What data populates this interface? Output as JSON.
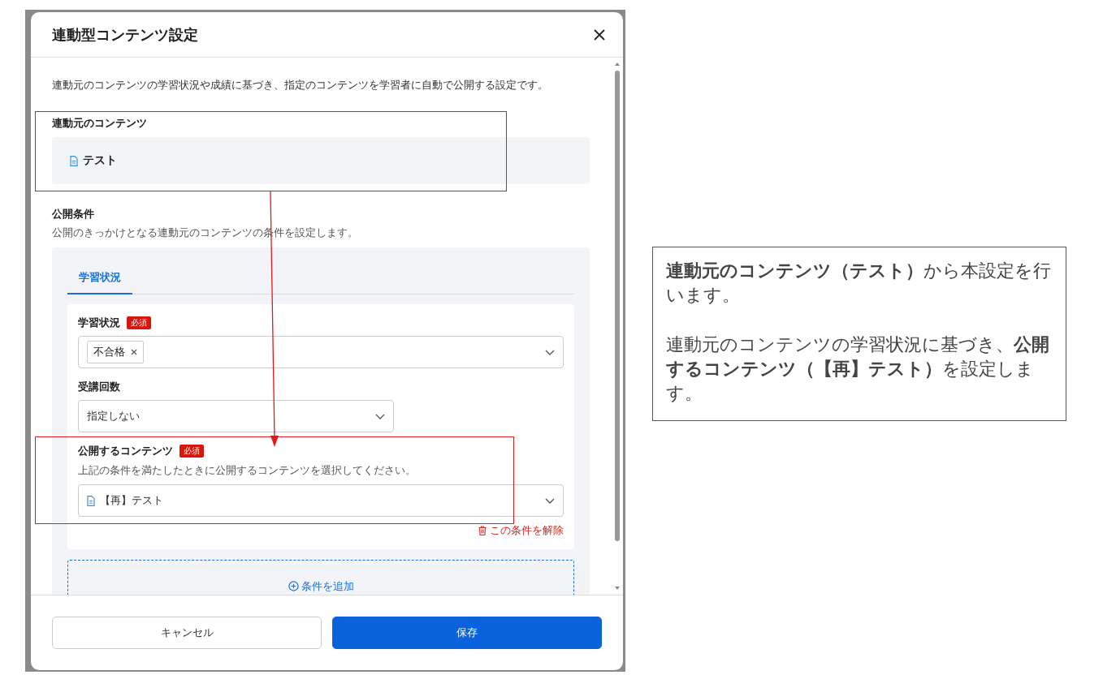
{
  "dialog": {
    "title": "連動型コンテンツ設定",
    "description": "連動元のコンテンツの学習状況や成績に基づき、指定のコンテンツを学習者に自動で公開する設定です。",
    "source": {
      "label": "連動元のコンテンツ",
      "item": "テスト"
    },
    "conditions": {
      "label": "公開条件",
      "description": "公開のきっかけとなる連動元のコンテンツの条件を設定します。",
      "tabs": [
        {
          "label": "学習状況",
          "selected": true
        }
      ],
      "fields": [
        {
          "kind": "multiselect",
          "label": "学習状況",
          "badge": "必須",
          "tags": [
            "不合格"
          ]
        },
        {
          "kind": "select",
          "label": "受講回数",
          "value": "指定しない"
        },
        {
          "kind": "content",
          "label": "公開するコンテンツ",
          "badge": "必須",
          "description": "上記の条件を満たしたときに公開するコンテンツを選択してください。",
          "value": "【再】テスト"
        }
      ],
      "remove_link": "この条件を解除",
      "add_button": "条件を追加"
    },
    "buttons": [
      {
        "kind": "secondary",
        "label": "キャンセル"
      },
      {
        "kind": "primary",
        "label": "保存"
      }
    ]
  },
  "callout": {
    "paragraphs": [
      "**連動元のコンテンツ（テスト）**から本設定を行います。",
      "連動元のコンテンツの学習状況に基づき、**公開するコンテンツ（【再】テスト）**を設定します。"
    ]
  }
}
